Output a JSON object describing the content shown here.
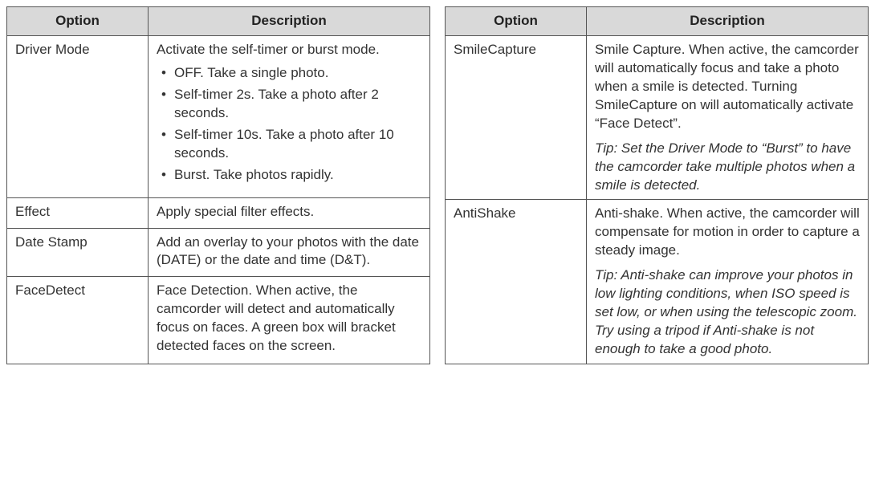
{
  "leftTable": {
    "headers": {
      "option": "Option",
      "description": "Description"
    },
    "rows": [
      {
        "option": "Driver Mode",
        "desc": "Activate the self-timer or burst mode.",
        "bullets": [
          "OFF. Take a single photo.",
          "Self-timer 2s. Take a photo after 2 seconds.",
          "Self-timer 10s. Take a photo after 10 seconds.",
          "Burst. Take photos rapidly."
        ]
      },
      {
        "option": "Effect",
        "desc": "Apply special filter effects."
      },
      {
        "option": "Date Stamp",
        "desc": "Add an overlay to your photos with the date (DATE) or the date and time (D&T)."
      },
      {
        "option": "FaceDetect",
        "desc": "Face Detection. When active, the camcorder will detect and automatically focus on faces. A green box will bracket detected faces on the screen."
      }
    ]
  },
  "rightTable": {
    "headers": {
      "option": "Option",
      "description": "Description"
    },
    "rows": [
      {
        "option": "SmileCapture",
        "desc": "Smile Capture. When active, the camcorder will automatically focus and take a photo when a smile is detected. Turning SmileCapture on will automatically activate “Face Detect”.",
        "tip": "Tip: Set the Driver Mode to “Burst” to have the camcorder take multiple photos when a smile is detected."
      },
      {
        "option": "AntiShake",
        "desc": "Anti-shake. When active, the camcorder will compensate for motion in order to capture a steady image.",
        "tip": "Tip: Anti-shake can improve your photos in low lighting conditions, when ISO speed is set low, or when using the telescopic zoom. Try using a tripod if Anti-shake is not enough to take a good photo."
      }
    ]
  }
}
